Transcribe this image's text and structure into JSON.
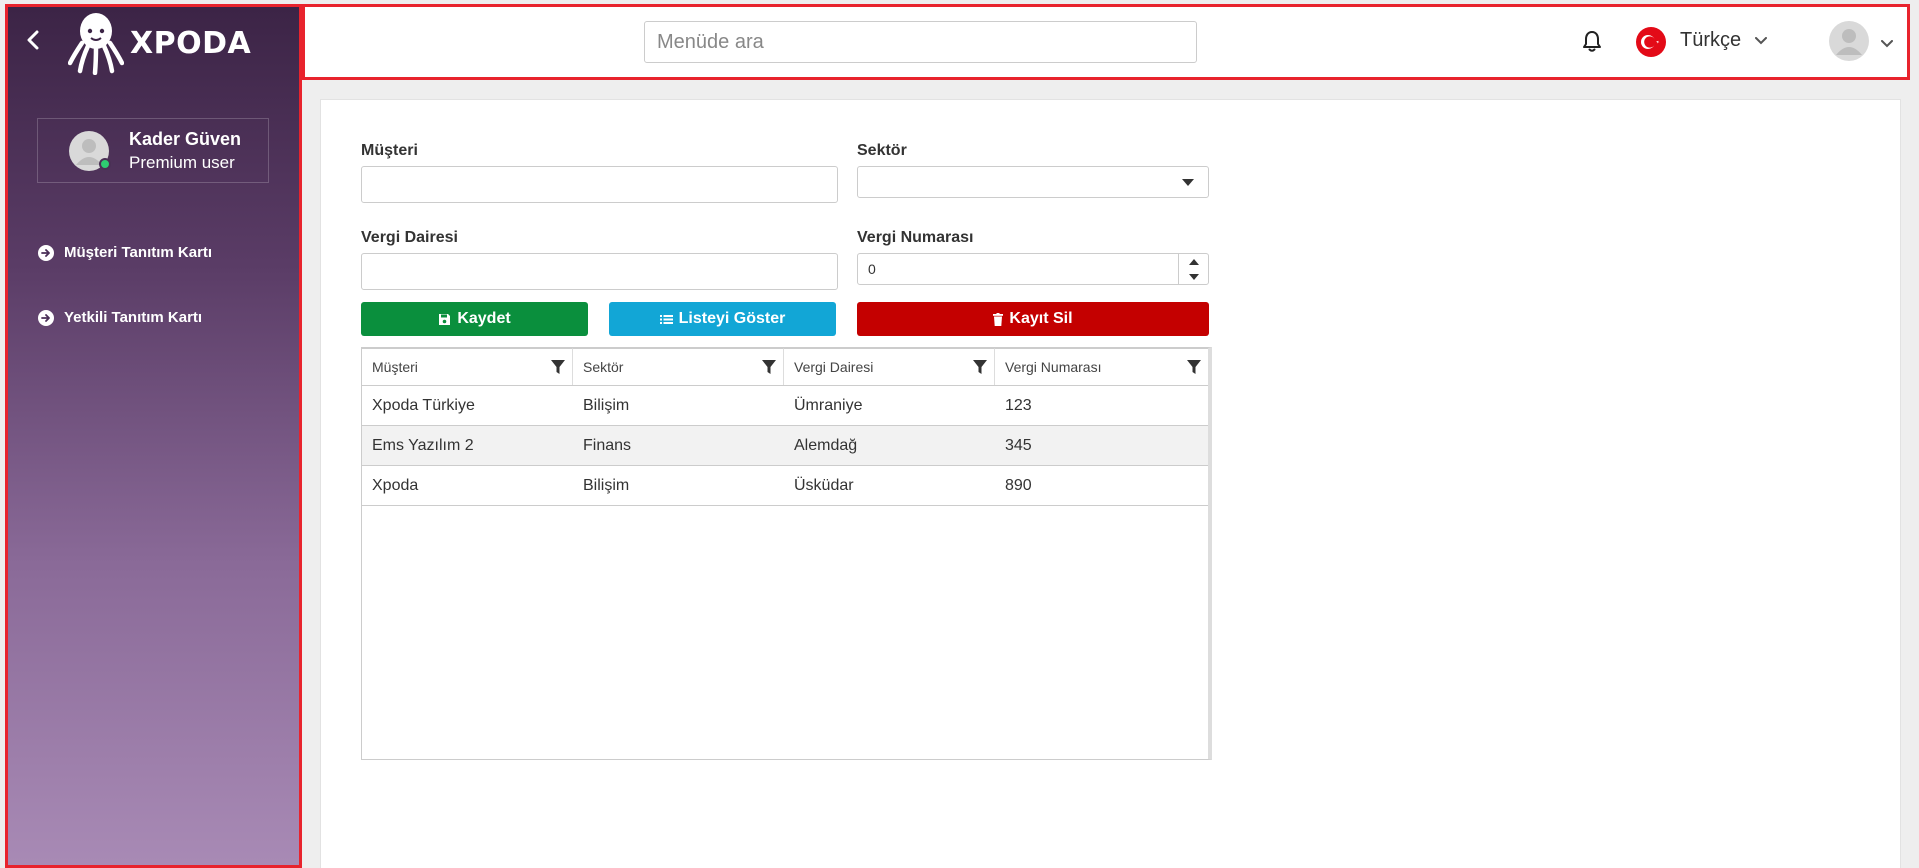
{
  "app": {
    "logo_text": "XPODA"
  },
  "user": {
    "name": "Kader Güven",
    "role": "Premium user"
  },
  "sidebar": {
    "items": [
      {
        "label": "Müşteri Tanıtım Kartı"
      },
      {
        "label": "Yetkili Tanıtım Kartı"
      }
    ]
  },
  "header": {
    "search_placeholder": "Menüde ara",
    "language": "Türkçe"
  },
  "form": {
    "customer_label": "Müşteri",
    "customer_value": "",
    "sector_label": "Sektör",
    "sector_value": "",
    "tax_office_label": "Vergi Dairesi",
    "tax_office_value": "",
    "tax_number_label": "Vergi Numarası",
    "tax_number_value": "0"
  },
  "buttons": {
    "save": "Kaydet",
    "show_list": "Listeyi Göster",
    "delete": "Kayıt Sil"
  },
  "colors": {
    "save": "#0a8f3d",
    "show_list": "#12a6d6",
    "delete": "#c40000",
    "highlight_border": "#e8232d"
  },
  "grid": {
    "columns": [
      "Müşteri",
      "Sektör",
      "Vergi Dairesi",
      "Vergi Numarası"
    ],
    "rows": [
      [
        "Xpoda Türkiye",
        "Bilişim",
        "Ümraniye",
        "123"
      ],
      [
        "Ems Yazılım 2",
        "Finans",
        "Alemdağ",
        "345"
      ],
      [
        "Xpoda",
        "Bilişim",
        "Üsküdar",
        "890"
      ]
    ]
  }
}
